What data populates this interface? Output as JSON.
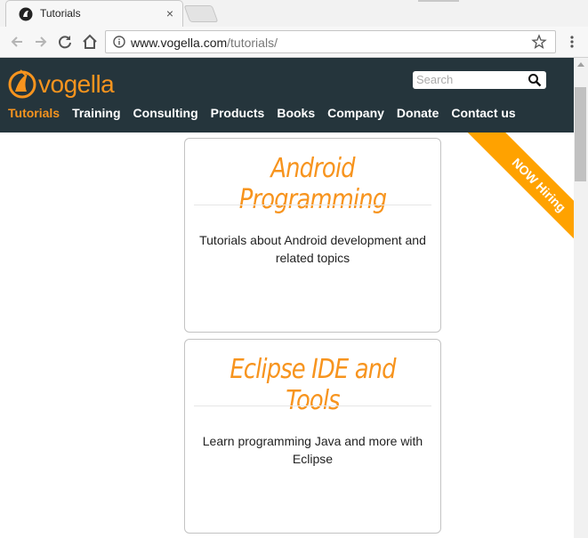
{
  "tab": {
    "title": "Tutorials",
    "close": "×"
  },
  "address_bar": {
    "url_host": "www.vogella.com",
    "url_path": "/tutorials/"
  },
  "site": {
    "logo_text": "vogella",
    "search_placeholder": "Search",
    "nav": [
      {
        "label": "Tutorials",
        "active": true
      },
      {
        "label": "Training"
      },
      {
        "label": "Consulting"
      },
      {
        "label": "Products"
      },
      {
        "label": "Books"
      },
      {
        "label": "Company"
      },
      {
        "label": "Donate"
      },
      {
        "label": "Contact us"
      }
    ],
    "ribbon": "NOW Hiring"
  },
  "cards": [
    {
      "title": "Android Programming",
      "description": "Tutorials about Android development and related topics"
    },
    {
      "title": "Eclipse IDE and Tools",
      "description": "Learn programming Java and more with Eclipse"
    }
  ],
  "colors": {
    "brand_orange": "#f7941e",
    "header_bg": "#25353c",
    "ribbon": "#ffa200"
  }
}
